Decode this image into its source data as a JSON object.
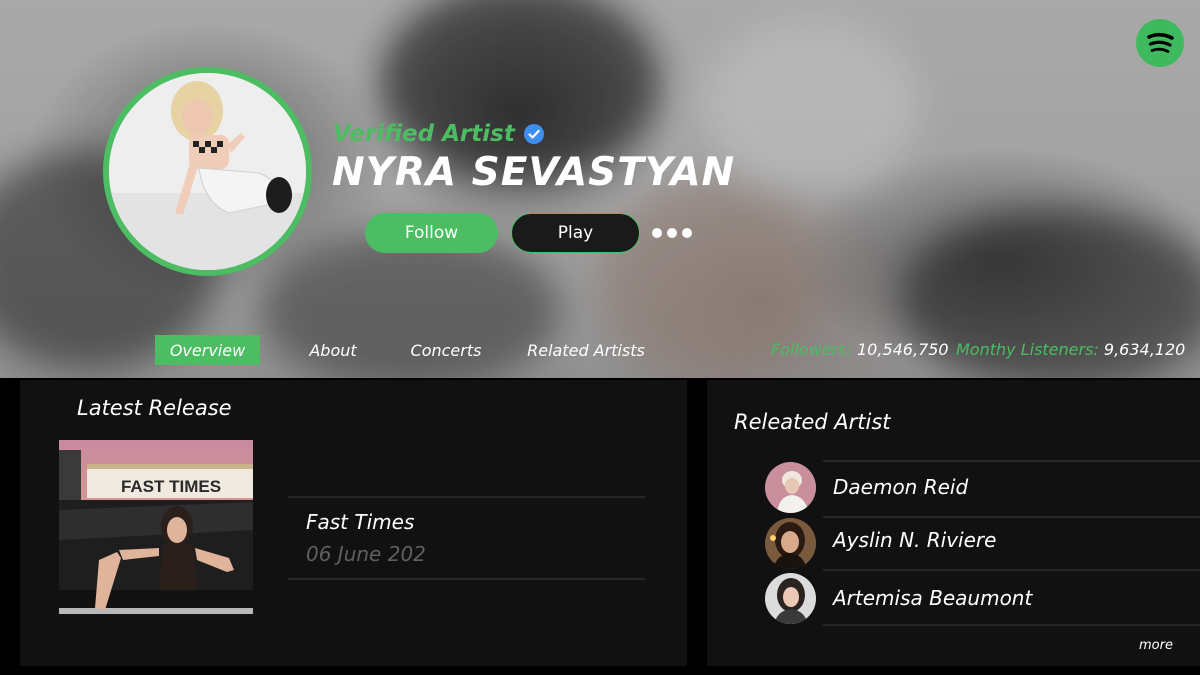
{
  "header": {
    "verified_label": "Verified Artist",
    "artist_name": "NYRA SEVASTYAN",
    "follow_label": "Follow",
    "play_label": "Play"
  },
  "tabs": [
    {
      "label": "Overview",
      "active": true
    },
    {
      "label": "About",
      "active": false
    },
    {
      "label": "Concerts",
      "active": false
    },
    {
      "label": "Related Artists",
      "active": false
    }
  ],
  "stats": {
    "followers_label": "Followers:",
    "followers_value": "10,546,750",
    "listeners_label": "Monthy Listeners:",
    "listeners_value": "9,634,120"
  },
  "latest_release": {
    "title": "Latest Release",
    "album_cover_text": "FAST TIMES",
    "name": "Fast Times",
    "date": "06 June 202"
  },
  "related": {
    "title": "Releated Artist",
    "artists": [
      {
        "name": "Daemon Reid"
      },
      {
        "name": "Ayslin N. Riviere"
      },
      {
        "name": "Artemisa Beaumont"
      }
    ],
    "more_label": "more"
  },
  "icons": {
    "logo": "spotify-logo-icon",
    "verified": "verified-badge-icon",
    "more": "more-options-icon"
  },
  "colors": {
    "accent": "#4cbd63",
    "verified_blue": "#3d8ef0",
    "panel_bg": "#111111",
    "page_bg": "#000000"
  }
}
